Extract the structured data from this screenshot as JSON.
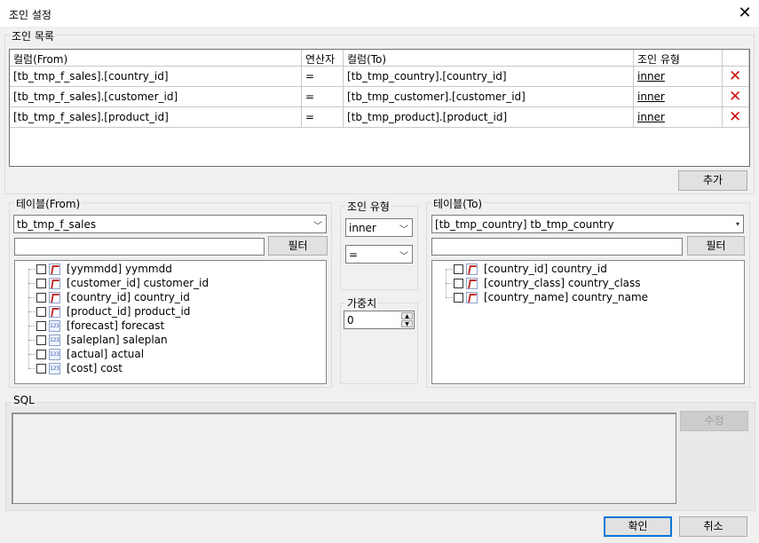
{
  "window": {
    "title": "조인 설정"
  },
  "join_list": {
    "label": "조인 목록",
    "columns": [
      "컬럼(From)",
      "연산자",
      "컬럼(To)",
      "조인 유형"
    ],
    "rows": [
      {
        "from": "[tb_tmp_f_sales].[country_id]",
        "op": "=",
        "to": "[tb_tmp_country].[country_id]",
        "type": "inner"
      },
      {
        "from": "[tb_tmp_f_sales].[customer_id]",
        "op": "=",
        "to": "[tb_tmp_customer].[customer_id]",
        "type": "inner"
      },
      {
        "from": "[tb_tmp_f_sales].[product_id]",
        "op": "=",
        "to": "[tb_tmp_product].[product_id]",
        "type": "inner"
      }
    ],
    "add_label": "추가"
  },
  "table_from": {
    "label": "테이블(From)",
    "selected": "tb_tmp_f_sales",
    "filter_value": "",
    "filter_label": "필터",
    "columns": [
      {
        "text": "[yymmdd] yymmdd",
        "icon": "key-icon"
      },
      {
        "text": "[customer_id] customer_id",
        "icon": "key-icon"
      },
      {
        "text": "[country_id] country_id",
        "icon": "key-icon"
      },
      {
        "text": "[product_id] product_id",
        "icon": "key-icon"
      },
      {
        "text": "[forecast] forecast",
        "icon": "numeric-icon"
      },
      {
        "text": "[saleplan] saleplan",
        "icon": "numeric-icon"
      },
      {
        "text": "[actual] actual",
        "icon": "numeric-icon"
      },
      {
        "text": "[cost] cost",
        "icon": "numeric-icon"
      }
    ]
  },
  "join_type": {
    "label": "조인 유형",
    "type_value": "inner",
    "op_value": "="
  },
  "weight": {
    "label": "가중치",
    "value": "0"
  },
  "table_to": {
    "label": "테이블(To)",
    "selected": "[tb_tmp_country] tb_tmp_country",
    "filter_value": "",
    "filter_label": "필터",
    "columns": [
      {
        "text": "[country_id] country_id",
        "icon": "key-icon"
      },
      {
        "text": "[country_class] country_class",
        "icon": "key-icon"
      },
      {
        "text": "[country_name] country_name",
        "icon": "key-icon"
      }
    ]
  },
  "sql": {
    "label": "SQL",
    "text": "",
    "edit_label": "수정"
  },
  "footer": {
    "ok_label": "확인",
    "cancel_label": "취소"
  },
  "colors": {
    "accent": "#0078d7",
    "delete": "#d01010"
  }
}
